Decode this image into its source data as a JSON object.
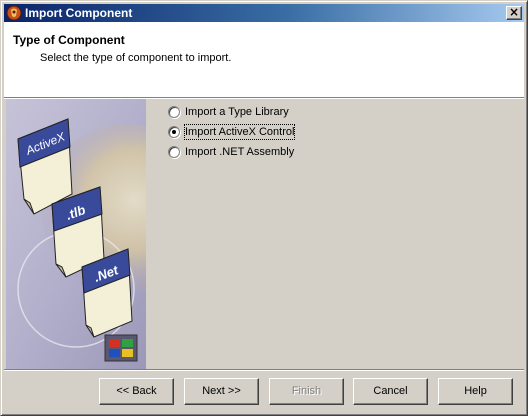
{
  "window": {
    "title": "Import Component",
    "close_glyph": "×"
  },
  "header": {
    "title": "Type of Component",
    "description": "Select the type of component to import."
  },
  "side_image": {
    "cards": [
      "ActiveX",
      ".tlb",
      ".Net"
    ]
  },
  "options": [
    {
      "label": "Import a Type Library",
      "selected": false
    },
    {
      "label": "Import ActiveX Control",
      "selected": true
    },
    {
      "label": "Import .NET Assembly",
      "selected": false
    }
  ],
  "buttons": {
    "back": "<< Back",
    "next": "Next >>",
    "finish": "Finish",
    "cancel": "Cancel",
    "help": "Help"
  },
  "colors": {
    "titlebar_start": "#0a246a",
    "titlebar_end": "#a6caf0",
    "dialog_face": "#d4d0c8",
    "card_blue": "#3a4a9a"
  }
}
